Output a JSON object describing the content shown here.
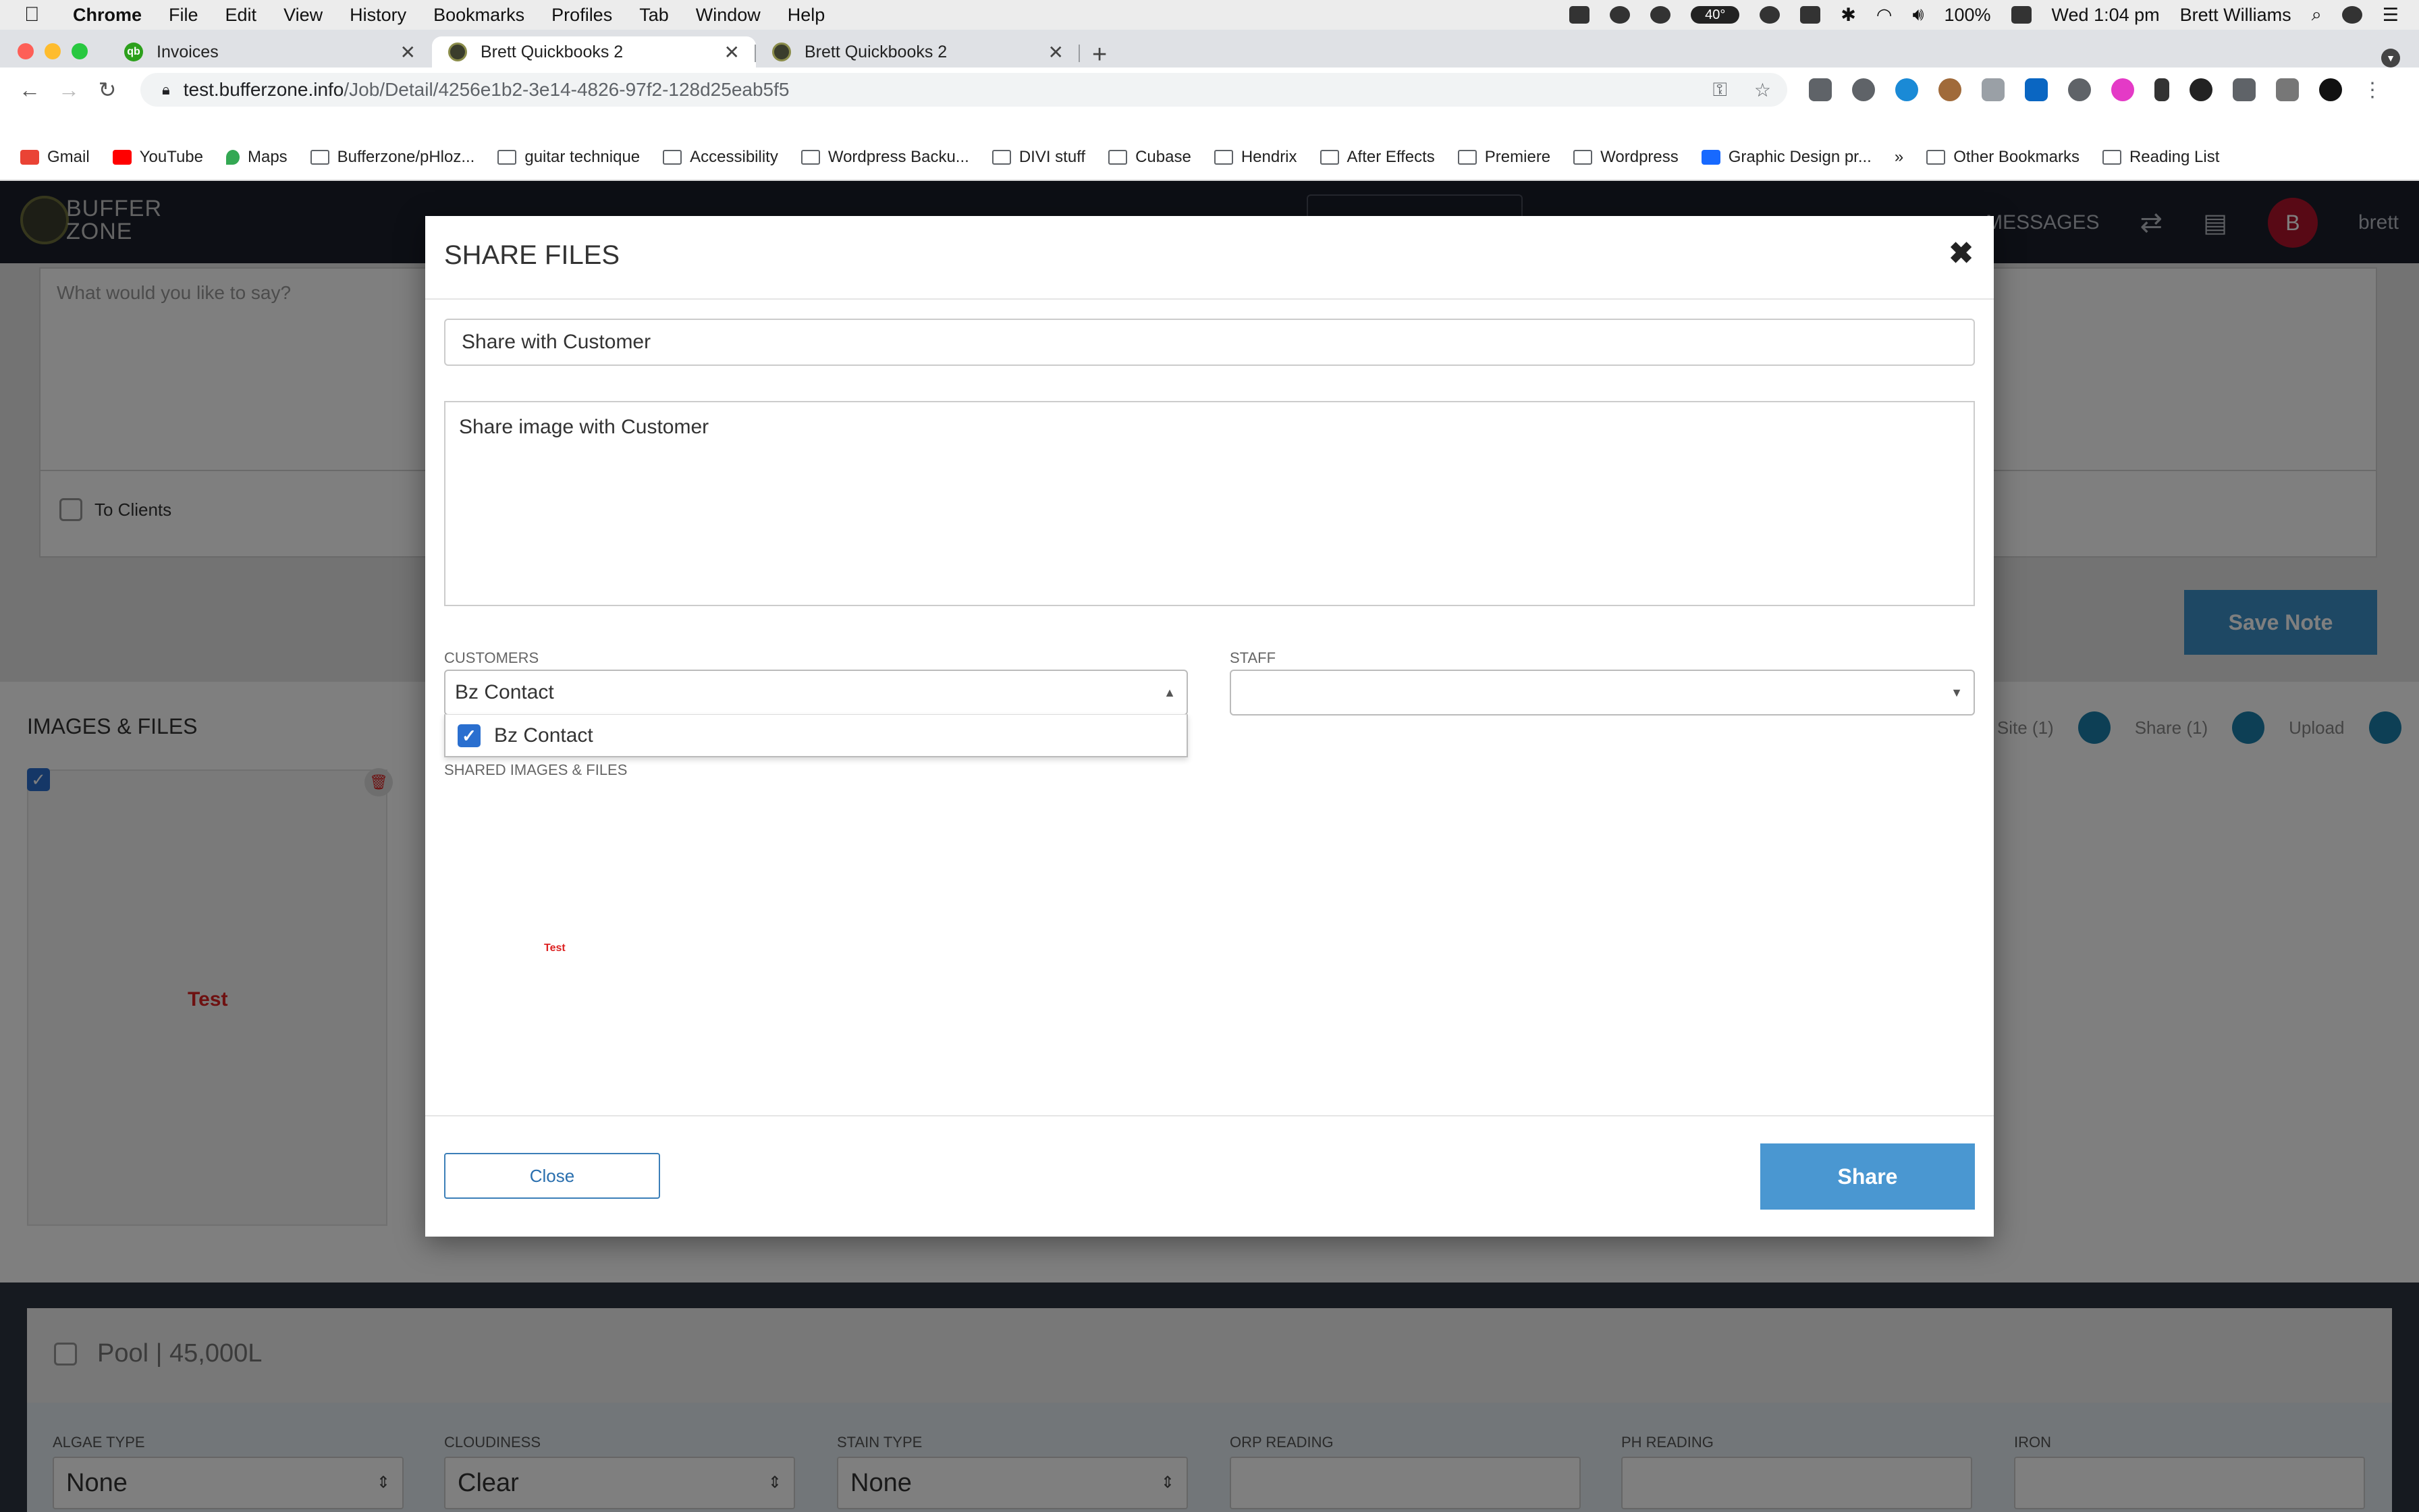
{
  "menubar": {
    "app": "Chrome",
    "items": [
      "File",
      "Edit",
      "View",
      "History",
      "Bookmarks",
      "Profiles",
      "Tab",
      "Window",
      "Help"
    ],
    "temp": "40°",
    "battery": "100%",
    "clock": "Wed 1:04 pm",
    "user": "Brett Williams"
  },
  "tabs": [
    {
      "title": "Invoices",
      "active": false
    },
    {
      "title": "Brett Quickbooks 2",
      "active": true
    },
    {
      "title": "Brett Quickbooks 2",
      "active": false
    }
  ],
  "address": {
    "host": "test.bufferzone.info",
    "path": "/Job/Detail/4256e1b2-3e14-4826-97f2-128d25eab5f5"
  },
  "bookmarks": [
    "Gmail",
    "YouTube",
    "Maps",
    "Bufferzone/pHloz...",
    "guitar technique",
    "Accessibility",
    "Wordpress Backu...",
    "DIVI stuff",
    "Cubase",
    "Hendrix",
    "After Effects",
    "Premiere",
    "Wordpress",
    "Graphic Design pr...",
    "»",
    "Other Bookmarks",
    "Reading List"
  ],
  "app": {
    "logo_line1": "BUFFER",
    "logo_line2": "ZONE",
    "nav_messages": "MESSAGES",
    "avatar_initial": "B",
    "username": "brett",
    "note_placeholder": "What would you like to say?",
    "to_clients": "To Clients",
    "save_note": "Save Note",
    "images_title": "IMAGES & FILES",
    "to_site": "to Site (1)",
    "share_count": "Share (1)",
    "upload": "Upload",
    "image_label": "Test",
    "pool_title": "Pool | 45,000L",
    "pool_fields": [
      {
        "label": "ALGAE TYPE",
        "value": "None"
      },
      {
        "label": "CLOUDINESS",
        "value": "Clear"
      },
      {
        "label": "STAIN TYPE",
        "value": "None"
      },
      {
        "label": "ORP READING",
        "value": ""
      },
      {
        "label": "PH READING",
        "value": ""
      },
      {
        "label": "IRON",
        "value": ""
      }
    ]
  },
  "modal": {
    "title": "SHARE FILES",
    "subject_value": "Share with Customer",
    "message_value": "Share image with Customer",
    "customers_label": "CUSTOMERS",
    "customers_selected": "Bz Contact",
    "staff_label": "STAFF",
    "staff_selected": "",
    "dropdown_option": "Bz Contact",
    "shared_label": "SHARED IMAGES & FILES",
    "shared_image_label": "Test",
    "close_label": "Close",
    "share_label": "Share"
  },
  "colors": {
    "primary": "#4a97d1",
    "checkbox": "#2a6fcf",
    "danger": "#d22222",
    "app_header": "#1b1f2a"
  }
}
